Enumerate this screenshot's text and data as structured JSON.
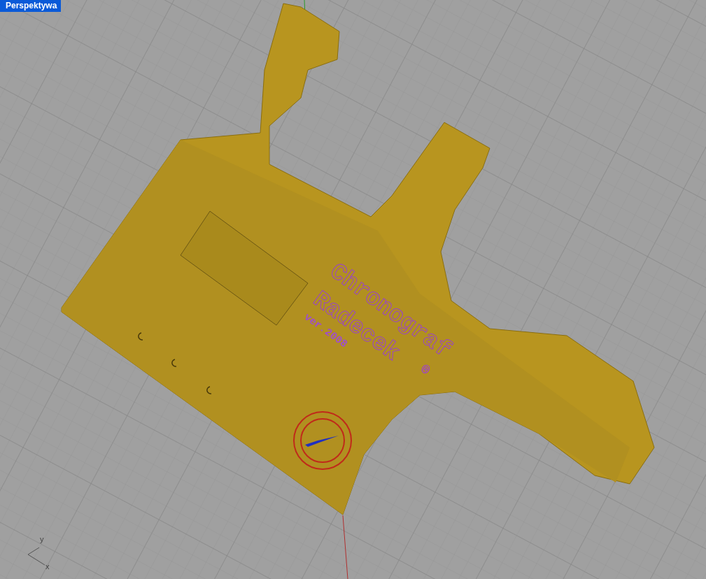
{
  "viewport": {
    "title": "Perspektywa"
  },
  "model_text": [
    {
      "kind": "outline",
      "text": "Chronograf"
    },
    {
      "kind": "outline",
      "text": "Radecek"
    },
    {
      "kind": "mark",
      "text": "®"
    },
    {
      "kind": "small",
      "text": "ver.2008"
    }
  ],
  "axis_labels": {
    "y": "y",
    "x": "x"
  }
}
